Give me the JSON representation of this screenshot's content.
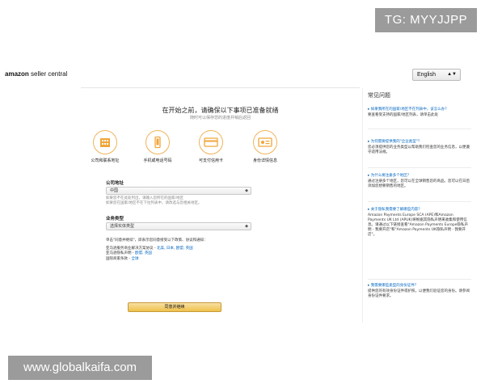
{
  "watermarks": {
    "telegram": "TG: MYYJJPP",
    "site": "www.globalkaifa.com"
  },
  "header": {
    "logo_brand": "amazon",
    "logo_suffix": " seller central",
    "language": "English"
  },
  "main": {
    "heading": "在开始之前，请确保以下事项已准备就绪",
    "subheading": "随时可以保存您的进度并稍后返回",
    "requirements": [
      {
        "label": "公司和联系地址",
        "icon": "building-icon"
      },
      {
        "label": "手机或电话号码",
        "icon": "phone-icon"
      },
      {
        "label": "可支付信用卡",
        "icon": "credit-card-icon"
      },
      {
        "label": "身份详情信息",
        "icon": "id-card-icon"
      }
    ],
    "company_location": {
      "label": "公司地址",
      "value": "中国",
      "hint_line1": "如果您不在此处列出，请输入您所在的国家/地区",
      "hint_line2": "如果您在国家/地区不在下拉列表中，请改选与您相关地区。"
    },
    "business_type": {
      "label": "业务类型",
      "placeholder": "选择实体类型"
    },
    "terms": {
      "line1": "单击\"同意并继续\"，即表示您同意接受以下政策、协议和通知：",
      "line2_prefix": "亚马逊服务商业解决方案协议 - ",
      "line2_links": "北美, 日本, 欧盟, 英国",
      "line3_prefix": "亚马逊隐私声明 - ",
      "line3_links": "欧盟, 英国",
      "line4_prefix": "国际商家条款 - ",
      "line4_links": "全球"
    },
    "agree_button": "同意并继续"
  },
  "faq": {
    "title": "常见问题",
    "items": [
      {
        "q": "▸ 如果我所在的国家/地区不在列表中，该怎么办？",
        "a": "要查看受支持的国家/地区列表，请单击此处"
      },
      {
        "q": "▸ 为何需要提供我的\"企业类型\"？",
        "a": "您必须提供您的业务类型以帮助我们检查您的业务信息，以便遵守适用法规。"
      },
      {
        "q": "▸ 为什么要注册多个地区？",
        "a": "通过注册多个地区，您可以在全球销售您的商品。您可以在日后添加您想要销售的地区。"
      },
      {
        "q": "▸ 关于隐私我需要了解哪些内容？",
        "a": "Amazon Payments Europe SCA (APE)和Amazon Payments UK Ltd (APUK)将根据其隐私声明来收集和使用信息。请通过以下链接查看\"Amazon Payments Europe隐私声明 - 我要开店\"和\"Amazon Payments UK隐私声明 - 我要开店\"。"
      },
      {
        "q": "▸ 我需要哪些类型的身份证件？",
        "a": "提供您的有效身份证件或护照，以便我们验证您的身份。请参阅身份证件要求。"
      }
    ]
  }
}
